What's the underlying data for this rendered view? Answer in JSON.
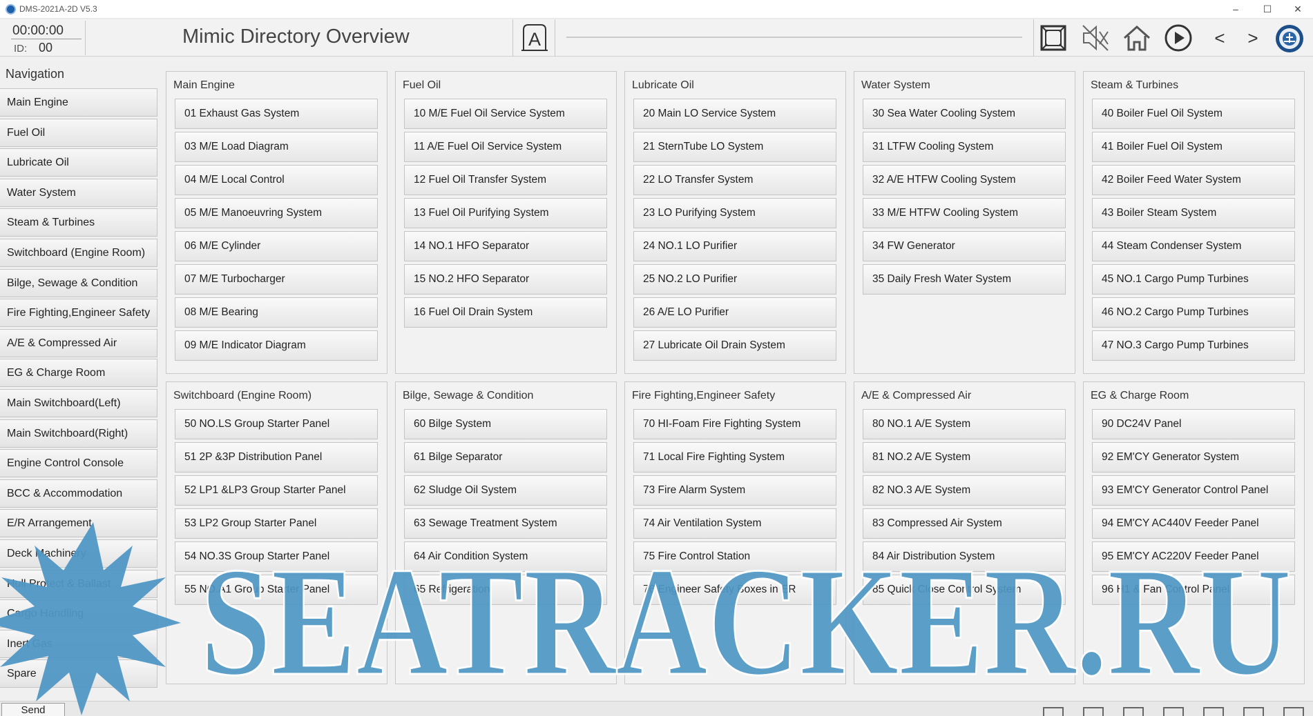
{
  "window": {
    "title": "DMS-2021A-2D V5.3",
    "minimize": "–",
    "maximize": "☐",
    "close": "✕"
  },
  "toolbar": {
    "clock": "00:00:00",
    "id_label": "ID:",
    "id_value": "00",
    "title": "Mimic Directory Overview",
    "alarm_letter": "A",
    "icons": [
      "fullscreen-icon",
      "mute-icon",
      "home-icon",
      "play-icon",
      "back-icon",
      "forward-icon",
      "logo-icon"
    ],
    "back": "<",
    "forward": ">"
  },
  "navigation": {
    "heading": "Navigation",
    "items": [
      "Main Engine",
      "Fuel Oil",
      "Lubricate Oil",
      "Water System",
      "Steam & Turbines",
      "Switchboard (Engine Room)",
      "Bilge, Sewage & Condition",
      "Fire Fighting,Engineer Safety",
      "A/E & Compressed Air",
      "EG & Charge Room",
      "Main Switchboard(Left)",
      "Main Switchboard(Right)",
      "Engine Control Console",
      "BCC & Accommodation",
      "E/R Arrangement",
      "Deck Machinery",
      "Hull Protect & Ballast",
      "Cargo Handling",
      "Inert Gas",
      "Spare"
    ]
  },
  "panels": [
    {
      "title": "Main Engine",
      "items": [
        "01  Exhaust Gas System",
        "03  M/E Load Diagram",
        "04  M/E Local Control",
        "05  M/E Manoeuvring System",
        "06  M/E Cylinder",
        "07  M/E Turbocharger",
        "08  M/E Bearing",
        "09  M/E Indicator Diagram"
      ]
    },
    {
      "title": "Fuel Oil",
      "items": [
        "10  M/E Fuel Oil Service System",
        "11  A/E Fuel Oil Service System",
        "12  Fuel Oil Transfer System",
        "13  Fuel Oil Purifying System",
        "14  NO.1 HFO Separator",
        "15  NO.2 HFO Separator",
        "16  Fuel Oil Drain System"
      ]
    },
    {
      "title": "Lubricate Oil",
      "items": [
        "20  Main LO Service System",
        "21  SternTube LO System",
        "22  LO Transfer System",
        "23  LO Purifying System",
        "24  NO.1 LO Purifier",
        "25  NO.2 LO Purifier",
        "26  A/E LO Purifier",
        "27  Lubricate Oil Drain System"
      ]
    },
    {
      "title": "Water System",
      "items": [
        "30  Sea Water Cooling System",
        "31  LTFW Cooling System",
        "32  A/E HTFW Cooling System",
        "33  M/E HTFW Cooling System",
        "34  FW Generator",
        "35  Daily Fresh Water System"
      ]
    },
    {
      "title": "Steam & Turbines",
      "items": [
        "40  Boiler Fuel Oil System",
        "41  Boiler Fuel Oil System",
        "42  Boiler Feed Water System",
        "43  Boiler Steam System",
        "44  Steam Condenser System",
        "45  NO.1 Cargo Pump Turbines",
        "46  NO.2 Cargo Pump Turbines",
        "47  NO.3 Cargo Pump Turbines"
      ]
    },
    {
      "title": "Switchboard (Engine Room)",
      "items": [
        "50  NO.LS Group Starter Panel",
        "51  2P &3P Distribution Panel",
        "52  LP1 &LP3 Group Starter Panel",
        "53  LP2 Group Starter Panel",
        "54  NO.3S Group Starter Panel",
        "55  NO.A1 Group Starter Panel"
      ]
    },
    {
      "title": "Bilge, Sewage & Condition",
      "items": [
        "60  Bilge System",
        "61  Bilge Separator",
        "62  Sludge Oil System",
        "63  Sewage Treatment System",
        "64  Air Condition System",
        "65  Refrigeration"
      ]
    },
    {
      "title": "Fire Fighting,Engineer Safety",
      "items": [
        "70  HI-Foam Fire Fighting System",
        "71  Local Fire Fighting System",
        "73  Fire Alarm System",
        "74  Air Ventilation System",
        "75  Fire Control Station",
        "76  Engineer Safety Boxes in ER"
      ]
    },
    {
      "title": "A/E & Compressed Air",
      "items": [
        "80  NO.1 A/E System",
        "81  NO.2 A/E System",
        "82  NO.3 A/E System",
        "83  Compressed Air System",
        "84  Air Distribution System",
        "85  Quick Close Control System"
      ]
    },
    {
      "title": "EG & Charge Room",
      "items": [
        "90  DC24V Panel",
        "92  EM'CY Generator System",
        "93  EM'CY Generator Control Panel",
        "94  EM'CY AC440V Feeder Panel",
        "95  EM'CY AC220V Feeder Panel",
        "96  H1 & Fan Control Panel"
      ]
    }
  ],
  "bottom": {
    "send_label": "Send"
  },
  "watermark": {
    "text": "SEATRACKER.RU",
    "color": "#4f97c4"
  }
}
